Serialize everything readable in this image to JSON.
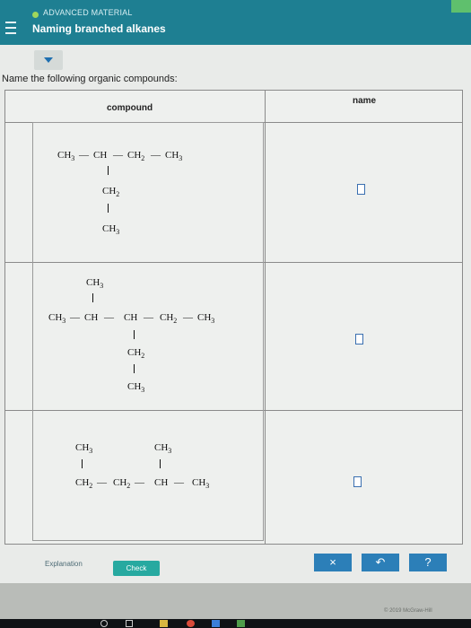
{
  "header": {
    "topic": "ADVANCED MATERIAL",
    "title": "Naming branched alkanes"
  },
  "prompt": "Name the following organic compounds:",
  "table": {
    "col_compound": "compound",
    "col_name": "name",
    "rows": [
      {
        "main_chain": [
          "CH3",
          "CH",
          "CH2",
          "CH3"
        ],
        "branch": [
          "CH2",
          "CH3"
        ]
      },
      {
        "top_branch": "CH3",
        "main_chain": [
          "CH3",
          "CH",
          "CH",
          "CH2",
          "CH3"
        ],
        "branch": [
          "CH2",
          "CH3"
        ]
      },
      {
        "top_branches": [
          "CH3",
          "CH3"
        ],
        "main_chain": [
          "CH2",
          "CH2",
          "CH",
          "CH3"
        ]
      }
    ]
  },
  "footer": {
    "explanation": "Explanation",
    "check": "Check",
    "clear": "×",
    "undo": "↶",
    "help": "?",
    "copyright": "© 2019 McGraw-Hill"
  },
  "colors": {
    "header": "#1e7f92",
    "check": "#27a9a0",
    "tool": "#2c7fb8"
  }
}
